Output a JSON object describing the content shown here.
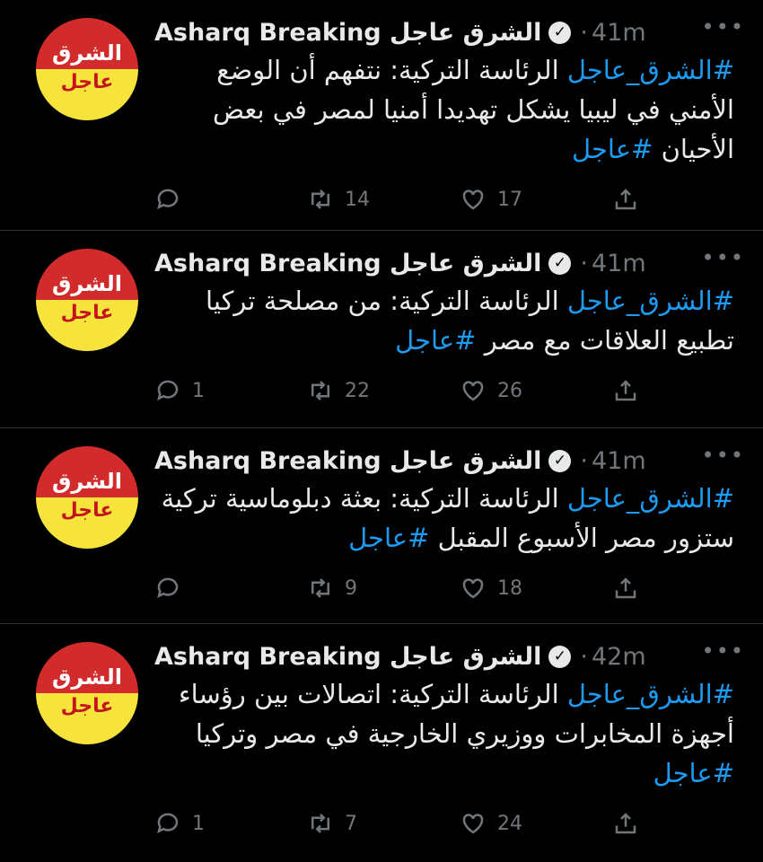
{
  "tweets": [
    {
      "avatar": {
        "top": "الشرق",
        "bottom": "عاجل"
      },
      "name": "Asharq Breaking الشرق عاجل",
      "time": "41m",
      "text": {
        "hashtag_start": "#الشرق_عاجل",
        "body": " الرئاسة التركية: نتفهم أن الوضع الأمني في ليبيا يشكل تهديدا أمنيا لمصر في بعض الأحيان ",
        "hashtag_end": "#عاجل"
      },
      "replies": "",
      "retweets": "14",
      "likes": "17"
    },
    {
      "avatar": {
        "top": "الشرق",
        "bottom": "عاجل"
      },
      "name": "Asharq Breaking الشرق عاجل",
      "time": "41m",
      "text": {
        "hashtag_start": "#الشرق_عاجل",
        "body": " الرئاسة التركية: من مصلحة تركيا تطبيع العلاقات مع مصر ",
        "hashtag_end": "#عاجل"
      },
      "replies": "1",
      "retweets": "22",
      "likes": "26"
    },
    {
      "avatar": {
        "top": "الشرق",
        "bottom": "عاجل"
      },
      "name": "Asharq Breaking الشرق عاجل",
      "time": "41m",
      "text": {
        "hashtag_start": "#الشرق_عاجل",
        "body": " الرئاسة التركية: بعثة دبلوماسية تركية ستزور مصر الأسبوع المقبل ",
        "hashtag_end": "#عاجل"
      },
      "replies": "",
      "retweets": "9",
      "likes": "18"
    },
    {
      "avatar": {
        "top": "الشرق",
        "bottom": "عاجل"
      },
      "name": "Asharq Breaking الشرق عاجل",
      "time": "42m",
      "text": {
        "hashtag_start": "#الشرق_عاجل",
        "body": " الرئاسة التركية: اتصالات بين رؤساء أجهزة المخابرات ووزيري الخارجية في مصر وتركيا ",
        "hashtag_end": "#عاجل"
      },
      "replies": "1",
      "retweets": "7",
      "likes": "24"
    }
  ],
  "icons": {
    "verified": "verified-badge-icon",
    "more": "more-dots-icon",
    "reply": "reply-icon",
    "retweet": "retweet-icon",
    "like": "heart-icon",
    "share": "share-icon"
  },
  "colors": {
    "background": "#000000",
    "text": "#e7e9ea",
    "muted": "#71767b",
    "link": "#1d9bf0",
    "avatar_red": "#d12c2b",
    "avatar_yellow": "#f6e43c"
  }
}
